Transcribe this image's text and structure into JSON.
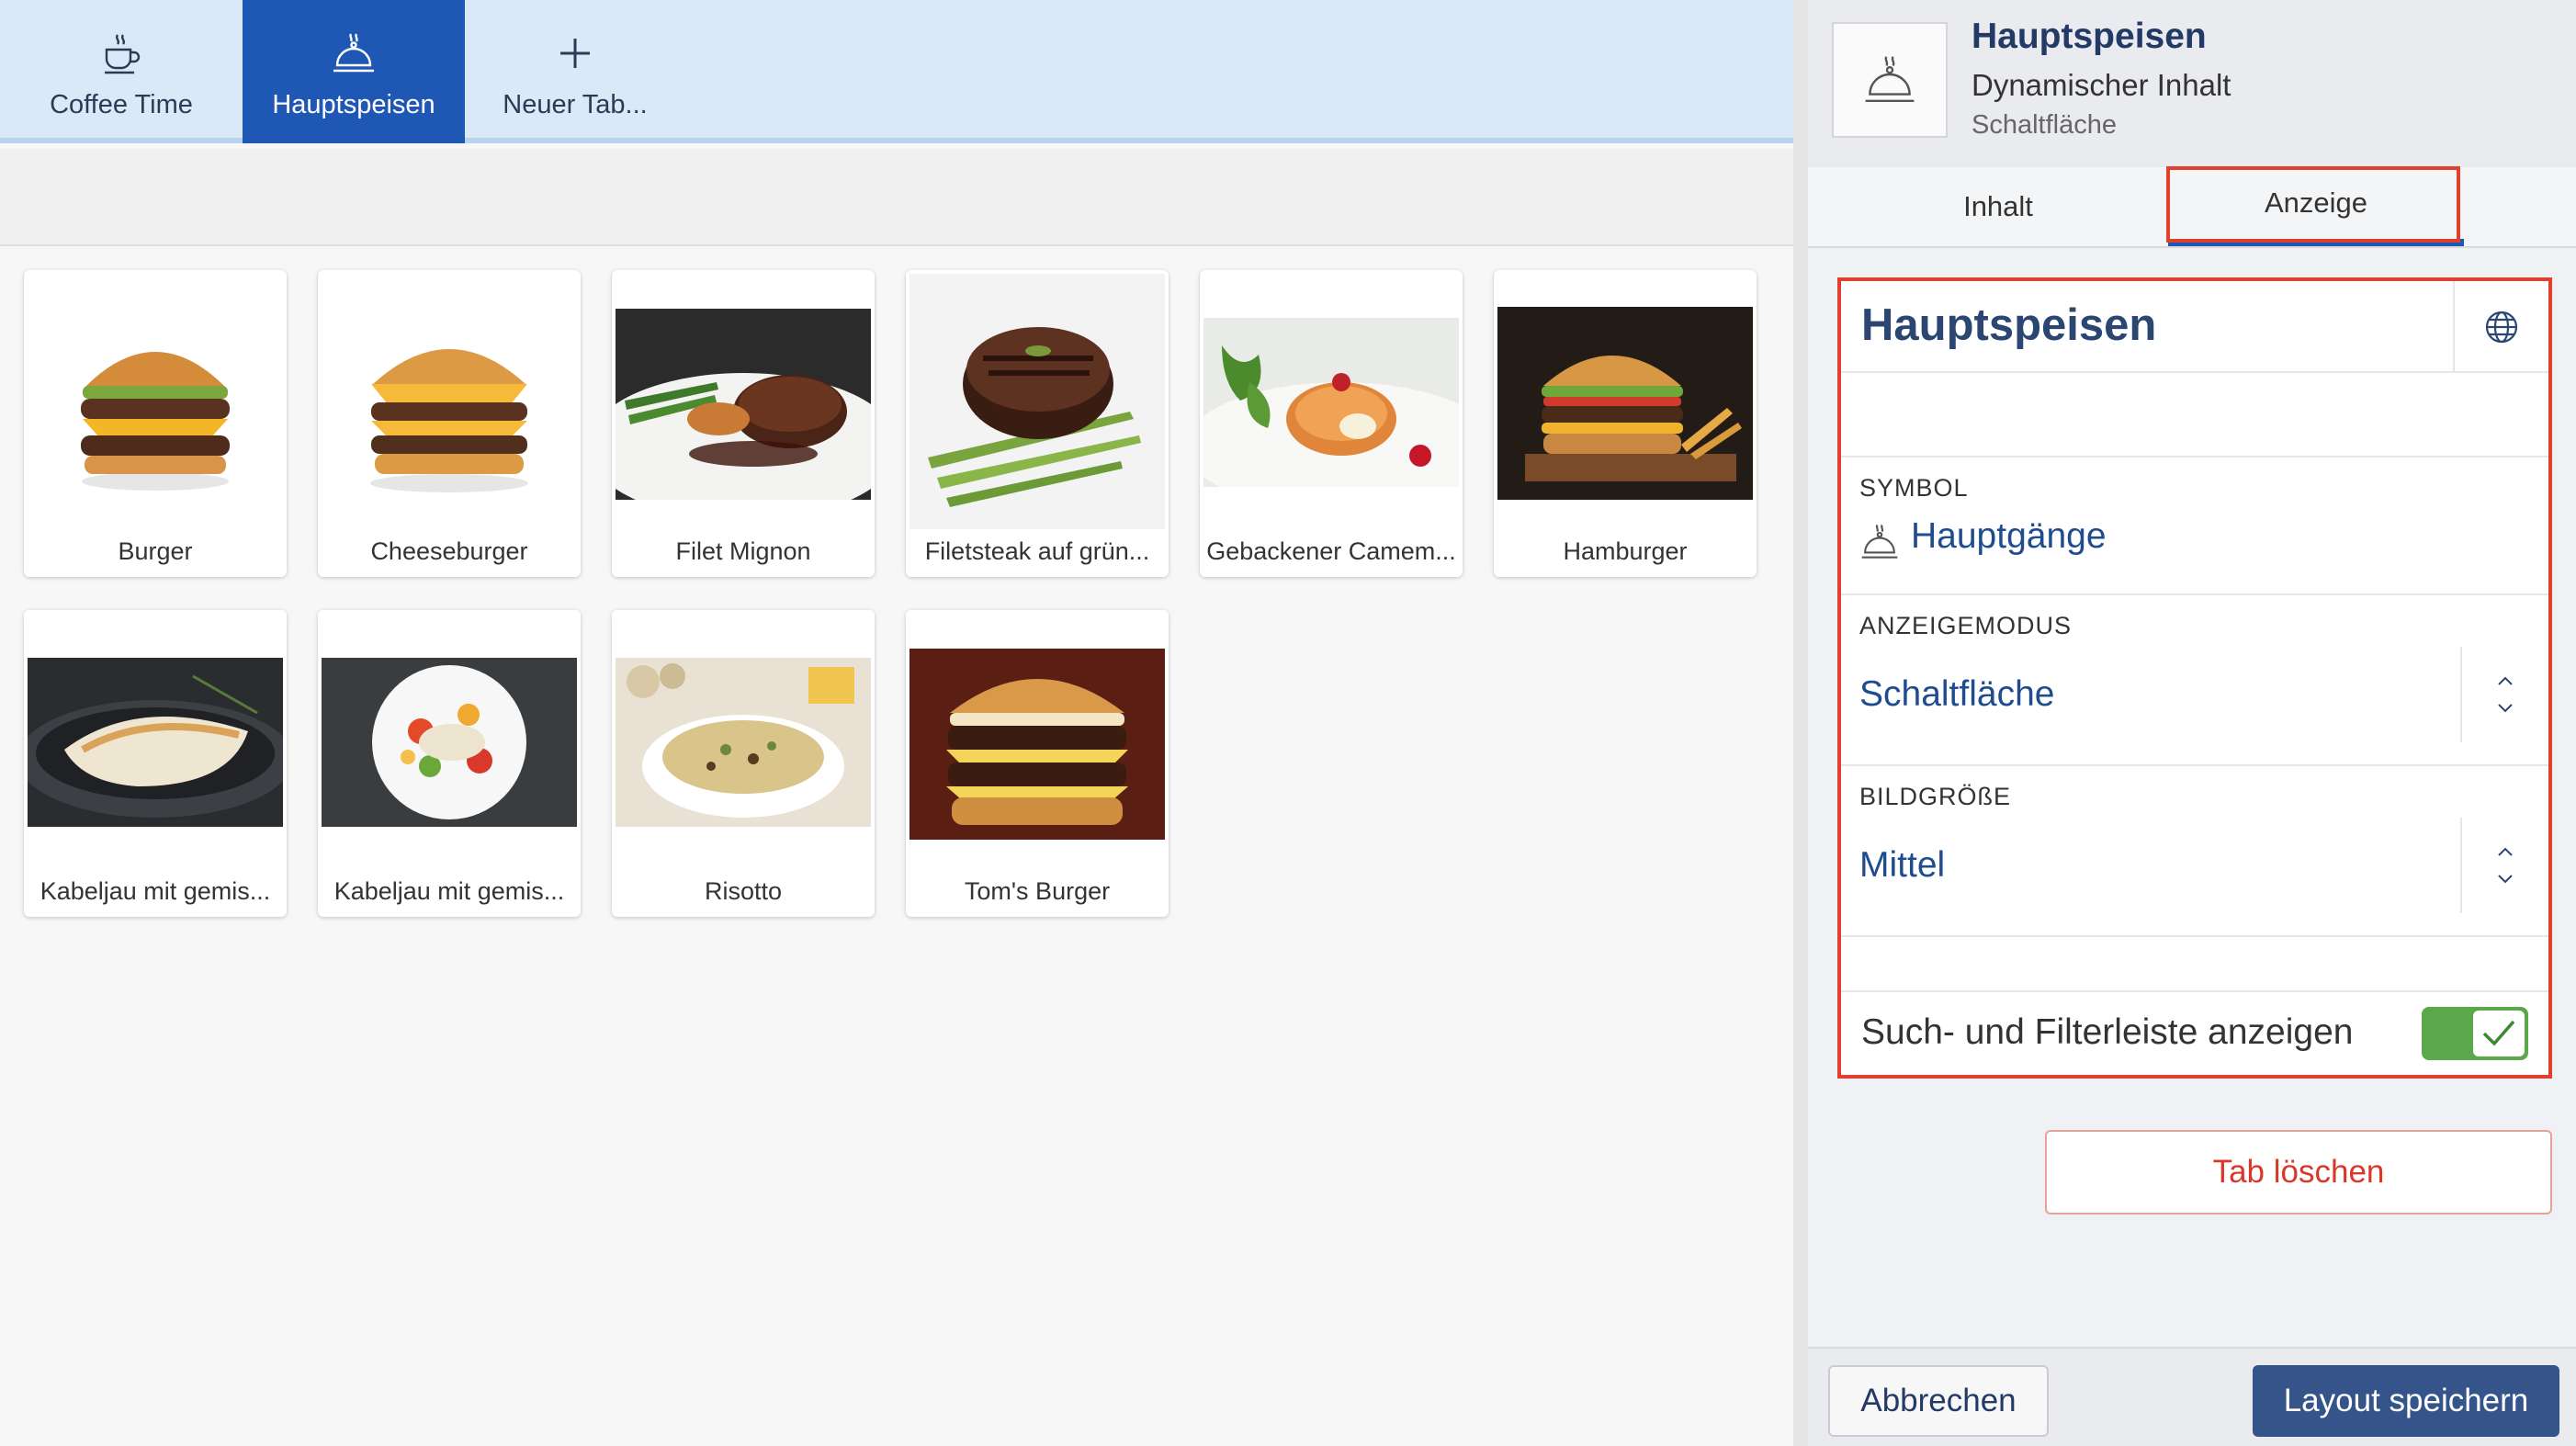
{
  "tabs": [
    {
      "label": "Coffee Time",
      "icon": "coffee-cup-icon",
      "active": false
    },
    {
      "label": "Hauptspeisen",
      "icon": "cloche-icon",
      "active": true
    },
    {
      "label": "Neuer Tab...",
      "icon": "plus-icon",
      "active": false
    }
  ],
  "products": [
    {
      "label": "Burger",
      "image": "burger-photo"
    },
    {
      "label": "Cheeseburger",
      "image": "cheeseburger-photo"
    },
    {
      "label": "Filet Mignon",
      "image": "filet-mignon-photo"
    },
    {
      "label": "Filetsteak auf grün...",
      "image": "filetsteak-photo"
    },
    {
      "label": "Gebackener Camem...",
      "image": "camembert-photo"
    },
    {
      "label": "Hamburger",
      "image": "hamburger-photo"
    },
    {
      "label": "Kabeljau mit gemis...",
      "image": "cod-pan-photo"
    },
    {
      "label": "Kabeljau mit gemis...",
      "image": "cod-plate-photo"
    },
    {
      "label": "Risotto",
      "image": "risotto-photo"
    },
    {
      "label": "Tom's Burger",
      "image": "toms-burger-photo"
    }
  ],
  "panel": {
    "header": {
      "title": "Hauptspeisen",
      "subtitle": "Dynamischer Inhalt",
      "type": "Schaltfläche",
      "icon": "cloche-icon"
    },
    "tabs": {
      "content": "Inhalt",
      "display": "Anzeige"
    },
    "form": {
      "title": "Hauptspeisen",
      "symbol_label": "SYMBOL",
      "symbol_value": "Hauptgänge",
      "display_mode_label": "ANZEIGEMODUS",
      "display_mode_value": "Schaltfläche",
      "image_size_label": "BILDGRÖßE",
      "image_size_value": "Mittel",
      "search_toggle_label": "Such- und Filterleiste anzeigen",
      "search_toggle_on": true
    },
    "delete_label": "Tab löschen",
    "cancel_label": "Abbrechen",
    "save_label": "Layout speichern"
  },
  "colors": {
    "accent_blue": "#1f57b4",
    "highlight_red": "#e0412e",
    "toggle_green": "#5aa84a",
    "save_button": "#34548a"
  }
}
